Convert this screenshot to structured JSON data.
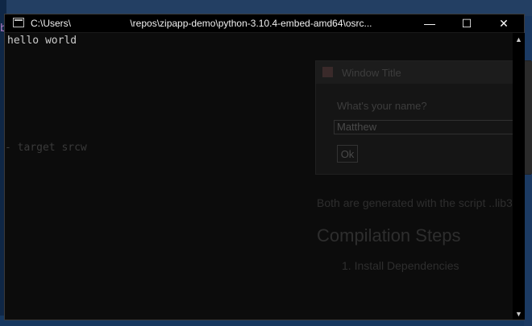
{
  "console": {
    "title": "C:\\Users\\                      \\repos\\zipapp-demo\\python-3.10.4-embed-amd64\\osrc...",
    "output_line": "hello world",
    "ghost_text": "- target srcw",
    "left_bleed_char": "b"
  },
  "window_controls": {
    "minimize": "—",
    "maximize": "☐",
    "close": "✕"
  },
  "scrollbar": {
    "up": "▲",
    "down": "▼"
  },
  "background": {
    "dialog_title": "Window Title",
    "dialog_question": "What's your name?",
    "dialog_entry_value": "Matthew",
    "dialog_ok": "Ok",
    "doc_line": "Both are generated with the script ..lib3",
    "doc_heading": "Compilation Steps",
    "doc_list_item": "1. Install Dependencies"
  }
}
